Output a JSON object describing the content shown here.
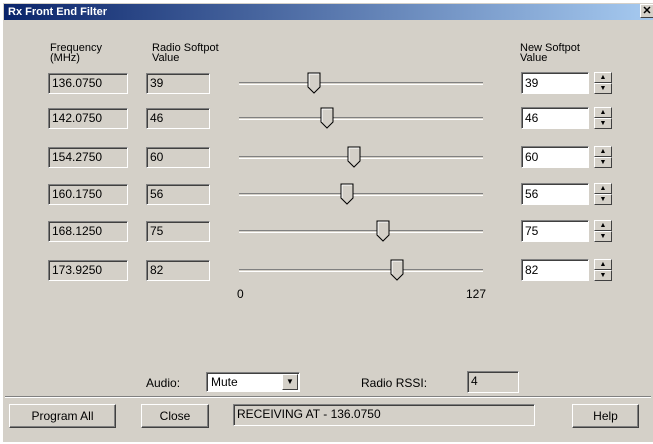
{
  "window": {
    "title": "Rx Front End Filter",
    "close_glyph": "✕"
  },
  "headers": {
    "frequency": "Frequency\n(MHz)",
    "radio_softpot": "Radio Softpot\nValue",
    "new_softpot": "New Softpot\nValue"
  },
  "rows": [
    {
      "frequency": "136.0750",
      "radio_value": "39",
      "new_value": "39",
      "slider_value": 39
    },
    {
      "frequency": "142.0750",
      "radio_value": "46",
      "new_value": "46",
      "slider_value": 46
    },
    {
      "frequency": "154.2750",
      "radio_value": "60",
      "new_value": "60",
      "slider_value": 60
    },
    {
      "frequency": "160.1750",
      "radio_value": "56",
      "new_value": "56",
      "slider_value": 56
    },
    {
      "frequency": "168.1250",
      "radio_value": "75",
      "new_value": "75",
      "slider_value": 75
    },
    {
      "frequency": "173.9250",
      "radio_value": "82",
      "new_value": "82",
      "slider_value": 82
    }
  ],
  "slider_scale": {
    "min_label": "0",
    "max_label": "127",
    "min": 0,
    "max": 127
  },
  "audio": {
    "label": "Audio:",
    "selected": "Mute"
  },
  "rssi": {
    "label": "Radio RSSI:",
    "value": "4"
  },
  "footer": {
    "program_all": "Program All",
    "close": "Close",
    "status": "RECEIVING AT - 136.0750",
    "help": "Help"
  }
}
